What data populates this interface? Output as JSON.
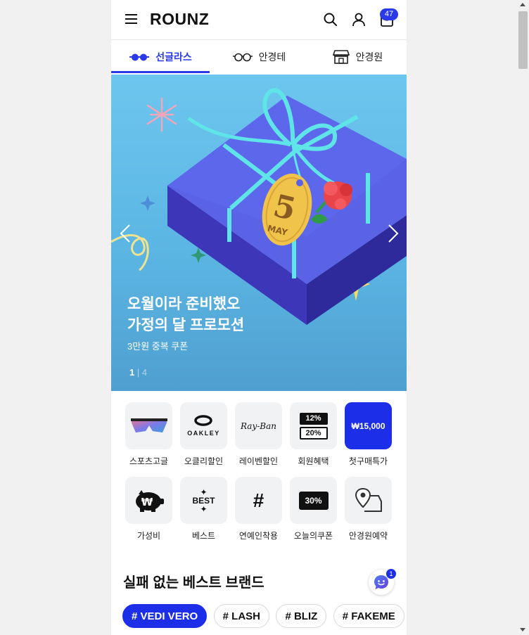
{
  "header": {
    "logo": "ROUNZ",
    "cart_count": "47"
  },
  "tabs": [
    {
      "label": "선글라스",
      "icon": "sunglasses-icon",
      "active": true
    },
    {
      "label": "안경테",
      "icon": "glasses-icon",
      "active": false
    },
    {
      "label": "안경원",
      "icon": "store-icon",
      "active": false
    }
  ],
  "banner": {
    "title_line1": "오월이라 준비했오",
    "title_line2": "가정의 달 프로모션",
    "subtitle": "3만원 중복 쿠폰",
    "page_current": "1",
    "page_sep": "|",
    "page_total": "4",
    "tag_number": "5",
    "tag_text": "MAY"
  },
  "categories": [
    {
      "label": "스포츠고글",
      "icon": "sport-goggle-icon"
    },
    {
      "label": "오클리할인",
      "icon": "oakley-logo-icon",
      "logo_text": "OAKLEY"
    },
    {
      "label": "레이벤할인",
      "icon": "rayban-logo-icon",
      "logo_text": "Ray-Ban"
    },
    {
      "label": "회원혜택",
      "icon": "coupon-icon",
      "coupon_top": "12%",
      "coupon_bottom": "20%"
    },
    {
      "label": "첫구매특가",
      "icon": "price-tag",
      "tile_text": "₩15,000"
    },
    {
      "label": "가성비",
      "icon": "piggy-bank-icon",
      "symbol": "₩"
    },
    {
      "label": "베스트",
      "icon": "best-icon",
      "tile_text": "BEST"
    },
    {
      "label": "연예인착용",
      "icon": "hashtag-icon",
      "tile_text": "#"
    },
    {
      "label": "오늘의쿠폰",
      "icon": "ticket-icon",
      "tile_text": "30%"
    },
    {
      "label": "안경원예약",
      "icon": "store-location-icon"
    }
  ],
  "best_brand": {
    "title": "실패 없는 베스트 브랜드",
    "chat_count": "1",
    "chips": [
      "# VEDI VERO",
      "# LASH",
      "# BLIZ",
      "# FAKEME"
    ]
  },
  "colors": {
    "accent": "#1c2ee8",
    "banner_bg": "#5ab4e2"
  }
}
